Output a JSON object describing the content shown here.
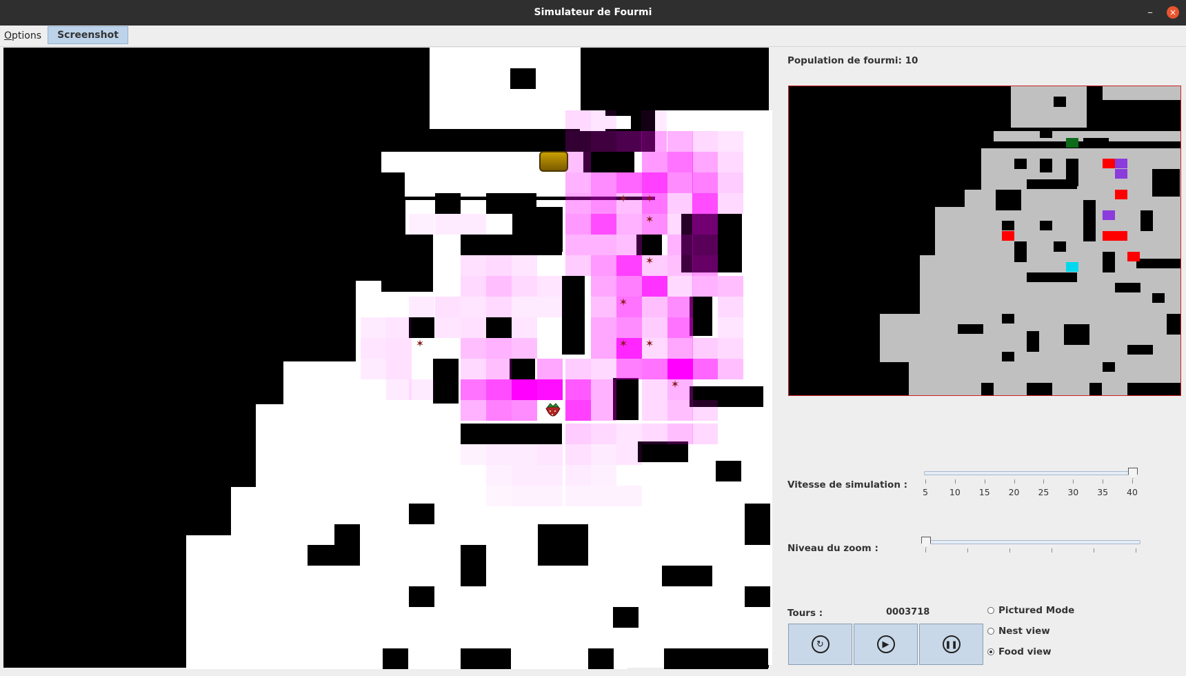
{
  "window": {
    "title": "Simulateur de Fourmi",
    "minimize_glyph": "–",
    "close_glyph": "×"
  },
  "menu": {
    "options_mnemonic": "O",
    "options_rest": "ptions",
    "screenshot": "Screenshot"
  },
  "panel": {
    "population_label": "Population de fourmi: 10",
    "speed_label": "Vitesse de simulation :",
    "speed_ticks": [
      "5",
      "10",
      "15",
      "20",
      "25",
      "30",
      "35",
      "40"
    ],
    "speed_value": 40,
    "zoom_label": "Niveau du zoom :",
    "zoom_value": 0,
    "tours_label": "Tours :",
    "tours_value": "0003718",
    "radio_options": [
      "Pictured Mode",
      "Nest view",
      "Food view"
    ],
    "radio_selected": "Food view"
  },
  "colors": {
    "wall": "#000000",
    "floor": "#ffffff",
    "pheromone": "#ff00ff",
    "ant": "#8a1c1c",
    "minimap_floor": "#c0c0c0",
    "minimap_border": "#cc2222"
  },
  "icons": {
    "nest": "basket-icon",
    "food": "strawberry-icon",
    "ant": "ant-icon",
    "reset": "reset-icon",
    "play": "play-icon",
    "pause": "pause-icon"
  }
}
